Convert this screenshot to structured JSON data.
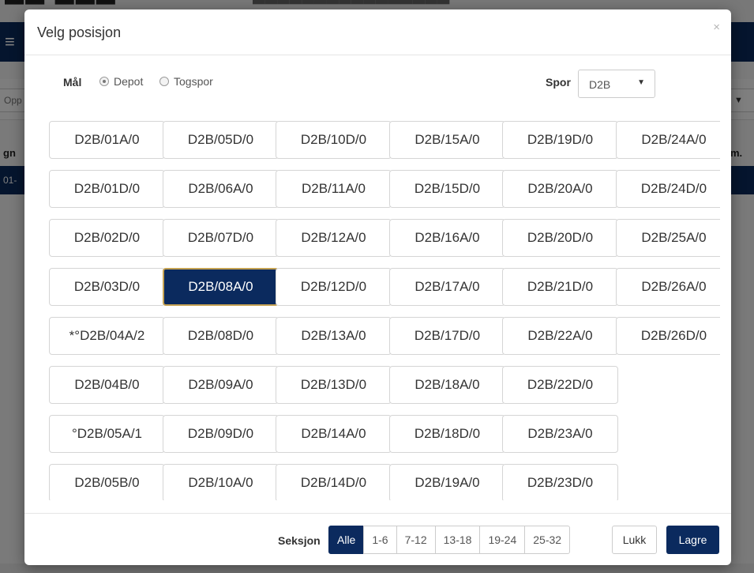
{
  "background": {
    "nav_menu_icon": "menu-icon",
    "filter_left_text": "Opp",
    "table_header_left": "gn",
    "table_header_right": "m.",
    "row_text": "01-"
  },
  "modal": {
    "title": "Velg posisjon",
    "close_symbol": "×",
    "mal": {
      "label": "Mål",
      "options": [
        "Depot",
        "Togspor"
      ],
      "selected": "Depot"
    },
    "spor": {
      "label": "Spor",
      "value": "D2B"
    },
    "selected_position": "D2B/08A/0",
    "positions": [
      [
        "D2B/01A/0",
        "D2B/01D/0",
        "D2B/02D/0",
        "D2B/03D/0",
        "*°D2B/04A/2",
        "D2B/04B/0",
        "°D2B/05A/1",
        "D2B/05B/0"
      ],
      [
        "D2B/05D/0",
        "D2B/06A/0",
        "D2B/07D/0",
        "D2B/08A/0",
        "D2B/08D/0",
        "D2B/09A/0",
        "D2B/09D/0",
        "D2B/10A/0"
      ],
      [
        "D2B/10D/0",
        "D2B/11A/0",
        "D2B/12A/0",
        "D2B/12D/0",
        "D2B/13A/0",
        "D2B/13D/0",
        "D2B/14A/0",
        "D2B/14D/0"
      ],
      [
        "D2B/15A/0",
        "D2B/15D/0",
        "D2B/16A/0",
        "D2B/17A/0",
        "D2B/17D/0",
        "D2B/18A/0",
        "D2B/18D/0",
        "D2B/19A/0"
      ],
      [
        "D2B/19D/0",
        "D2B/20A/0",
        "D2B/20D/0",
        "D2B/21D/0",
        "D2B/22A/0",
        "D2B/22D/0",
        "D2B/23A/0",
        "D2B/23D/0"
      ],
      [
        "D2B/24A/0",
        "D2B/24D/0",
        "D2B/25A/0",
        "D2B/26A/0",
        "D2B/26D/0"
      ]
    ],
    "footer": {
      "seksjon_label": "Seksjon",
      "sections": [
        "Alle",
        "1-6",
        "7-12",
        "13-18",
        "19-24",
        "25-32"
      ],
      "active_section": "Alle",
      "close_label": "Lukk",
      "save_label": "Lagre"
    }
  },
  "colors": {
    "primary": "#0b2a5e",
    "selected_border": "#c5a253"
  }
}
